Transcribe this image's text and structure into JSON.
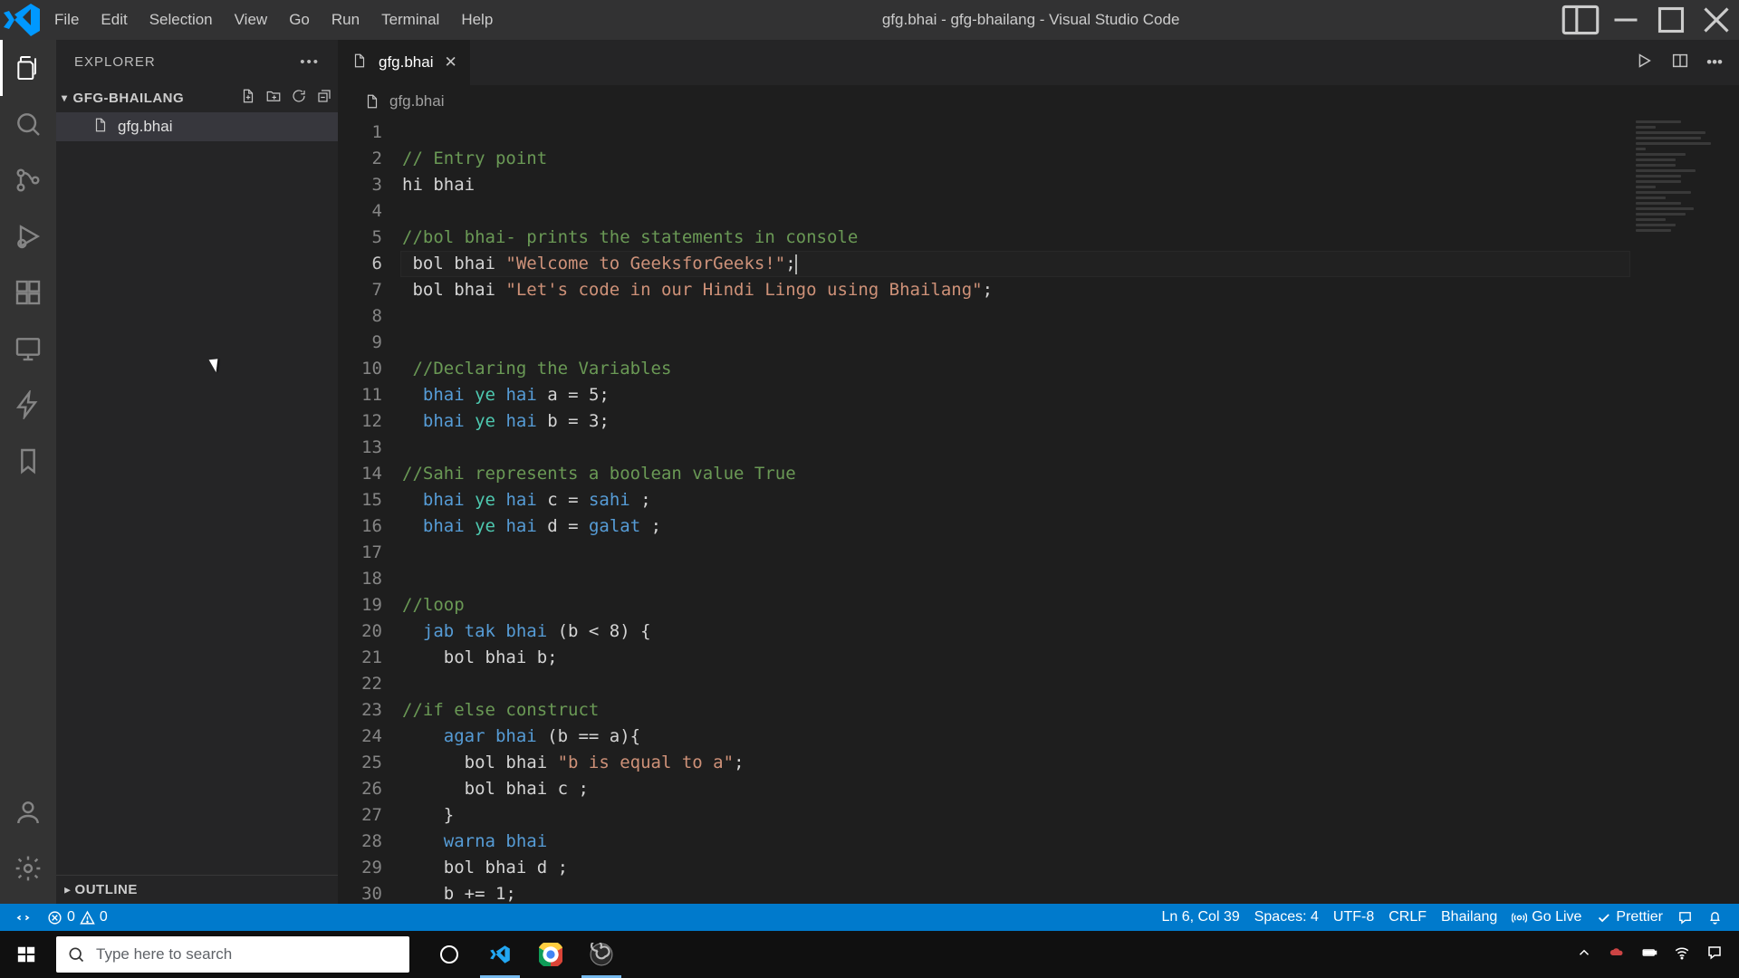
{
  "titlebar": {
    "menus": [
      "File",
      "Edit",
      "Selection",
      "View",
      "Go",
      "Run",
      "Terminal",
      "Help"
    ],
    "title": "gfg.bhai - gfg-bhailang - Visual Studio Code"
  },
  "sidebar": {
    "title": "EXPLORER",
    "workspace": "GFG-BHAILANG",
    "files": [
      "gfg.bhai"
    ],
    "outline": "OUTLINE"
  },
  "tab": {
    "filename": "gfg.bhai"
  },
  "breadcrumb": {
    "file": "gfg.bhai"
  },
  "code_lines": [
    {
      "n": 1,
      "t": ""
    },
    {
      "n": 2,
      "t": "comment",
      "text": "// Entry point"
    },
    {
      "n": 3,
      "t": "plain",
      "text": "hi bhai"
    },
    {
      "n": 4,
      "t": ""
    },
    {
      "n": 5,
      "t": "comment",
      "text": "//bol bhai- prints the statements in console"
    },
    {
      "n": 6,
      "t": "bolstr",
      "pre": " bol bhai ",
      "str": "\"Welcome to GeeksforGeeks!\"",
      "post": ";",
      "cursor": true,
      "current": true
    },
    {
      "n": 7,
      "t": "bolstr",
      "pre": " bol bhai ",
      "str": "\"Let's code in our Hindi Lingo using Bhailang\"",
      "post": ";"
    },
    {
      "n": 8,
      "t": ""
    },
    {
      "n": 9,
      "t": ""
    },
    {
      "n": 10,
      "t": "comment",
      "text": " //Declaring the Variables"
    },
    {
      "n": 11,
      "t": "decl",
      "name": "a",
      "val": "5"
    },
    {
      "n": 12,
      "t": "decl",
      "name": "b",
      "val": "3"
    },
    {
      "n": 13,
      "t": ""
    },
    {
      "n": 14,
      "t": "comment",
      "text": "//Sahi represents a boolean value True"
    },
    {
      "n": 15,
      "t": "declkw",
      "name": "c",
      "val": "sahi"
    },
    {
      "n": 16,
      "t": "declkw",
      "name": "d",
      "val": "galat"
    },
    {
      "n": 17,
      "t": ""
    },
    {
      "n": 18,
      "t": ""
    },
    {
      "n": 19,
      "t": "comment",
      "text": "//loop"
    },
    {
      "n": 20,
      "t": "loop",
      "head": "  jab tak bhai",
      "cond": "(b < 8) {"
    },
    {
      "n": 21,
      "t": "plain",
      "text": "    bol bhai b;"
    },
    {
      "n": 22,
      "t": ""
    },
    {
      "n": 23,
      "t": "comment",
      "text": "//if else construct"
    },
    {
      "n": 24,
      "t": "if",
      "head": "    agar bhai",
      "cond": "(b == a){"
    },
    {
      "n": 25,
      "t": "bolstr",
      "pre": "      bol bhai ",
      "str": "\"b is equal to a\"",
      "post": ";"
    },
    {
      "n": 26,
      "t": "plain",
      "text": "      bol bhai c ;"
    },
    {
      "n": 27,
      "t": "plain",
      "text": "    }"
    },
    {
      "n": 28,
      "t": "else",
      "head": "    warna bhai"
    },
    {
      "n": 29,
      "t": "plain",
      "text": "    bol bhai d ;"
    },
    {
      "n": 30,
      "t": "plain",
      "text": "    b += 1;"
    }
  ],
  "statusbar": {
    "errors": "0",
    "warnings": "0",
    "position": "Ln 6, Col 39",
    "spaces": "Spaces: 4",
    "encoding": "UTF-8",
    "eol": "CRLF",
    "language": "Bhailang",
    "golive": "Go Live",
    "prettier": "Prettier"
  },
  "taskbar": {
    "search_placeholder": "Type here to search"
  }
}
